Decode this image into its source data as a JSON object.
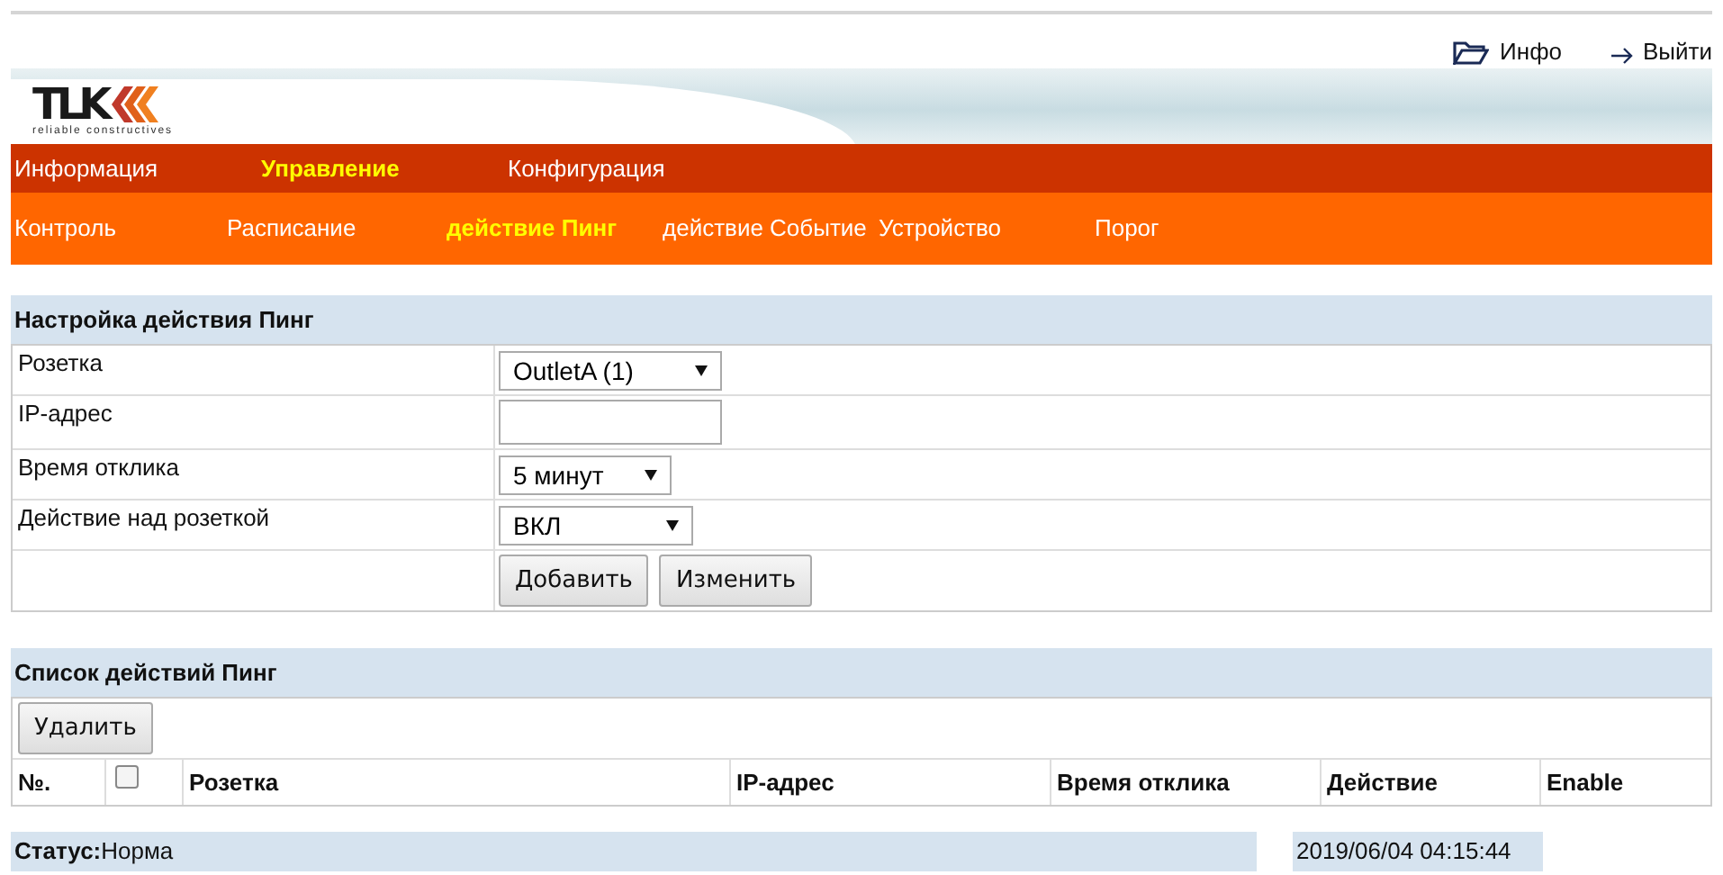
{
  "top_links": [
    {
      "kind": "folder",
      "label": "Инфо"
    },
    {
      "kind": "exit",
      "label": "Выйти"
    }
  ],
  "logo": {
    "text": "TLK",
    "tagline": "reliable constructives"
  },
  "main_menu": [
    {
      "label": "Информация",
      "selected": false
    },
    {
      "label": "Управление",
      "selected": true
    },
    {
      "label": "Конфигурация",
      "selected": false
    }
  ],
  "sub_menu": [
    {
      "label": "Контроль",
      "selected": false
    },
    {
      "label": "Расписание",
      "selected": false
    },
    {
      "label": "действие Пинг",
      "selected": true
    },
    {
      "label": "действие Событие",
      "selected": false
    },
    {
      "label": "Устройство",
      "selected": false
    },
    {
      "label": "Порог",
      "selected": false
    }
  ],
  "settings": {
    "title": "Настройка действия Пинг",
    "rows": [
      {
        "kind": "select",
        "label": "Розетка",
        "value": "OutletA (1)"
      },
      {
        "kind": "input",
        "label": "IP-адрес"
      },
      {
        "kind": "select",
        "label": "Время отклика",
        "value": "5 минут"
      },
      {
        "kind": "select",
        "label": "Действие над розеткой",
        "value": "ВКЛ"
      }
    ],
    "buttons": [
      "Добавить",
      "Изменить"
    ]
  },
  "list": {
    "title": "Список действий Пинг",
    "delete_button": "Удалить",
    "columns": [
      {
        "kind": "text",
        "label": "№."
      },
      {
        "kind": "checkbox",
        "checked": false
      },
      {
        "kind": "text",
        "label": "Розетка"
      },
      {
        "kind": "text",
        "label": "IP-адрес"
      },
      {
        "kind": "text",
        "label": "Время отклика"
      },
      {
        "kind": "text",
        "label": "Действие"
      },
      {
        "kind": "text",
        "label": "Enable"
      }
    ]
  },
  "status_bar": {
    "status": "**Статус:**Норма",
    "datetime": "2019/06/04 04:15:44"
  }
}
